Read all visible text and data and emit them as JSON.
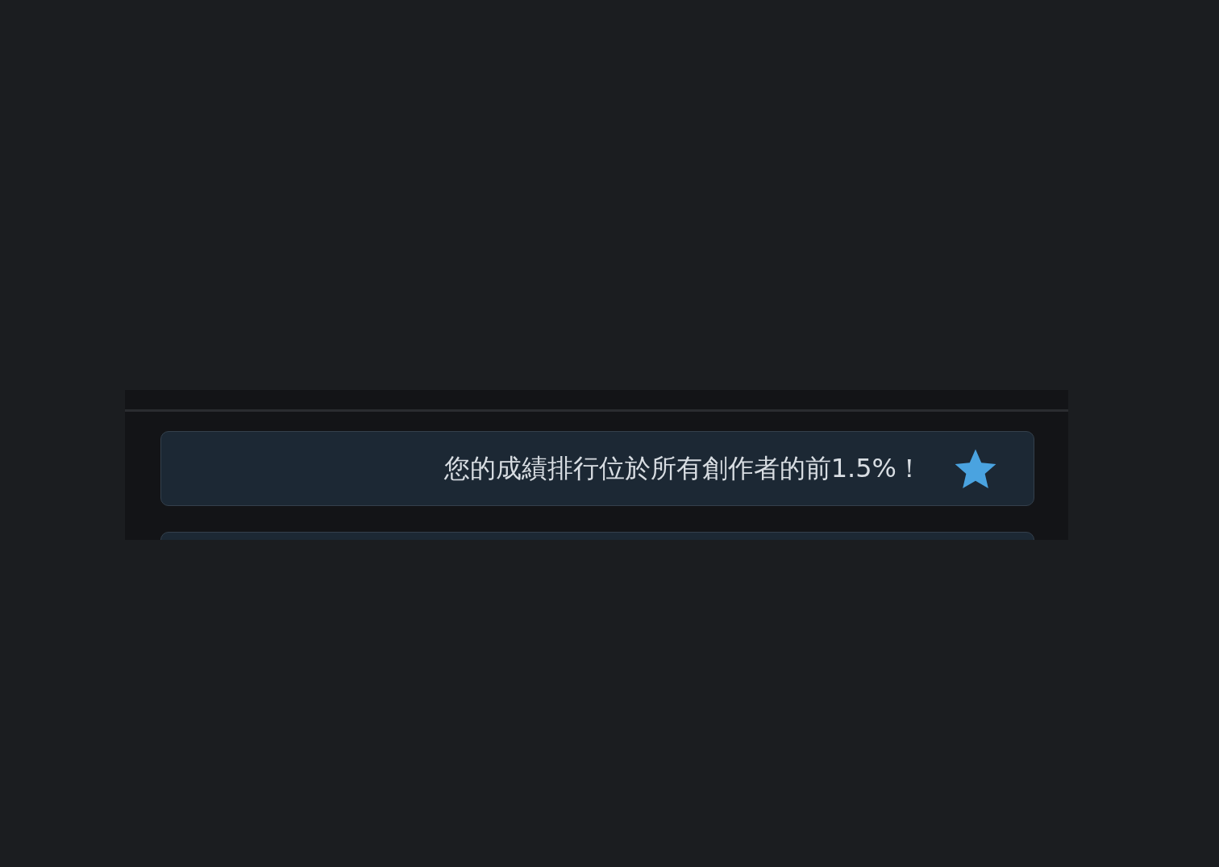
{
  "notices": [
    {
      "kind": "starred",
      "message": "您的成績排行位於所有創作者的前1.5%！"
    },
    {
      "kind": "plain"
    }
  ]
}
